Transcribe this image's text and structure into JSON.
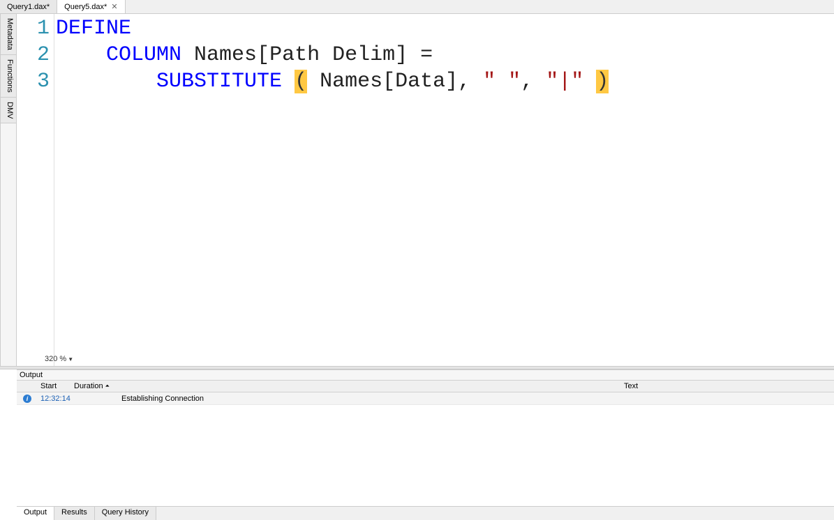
{
  "tabs": [
    {
      "label": "Query1.dax*"
    },
    {
      "label": "Query5.dax*"
    }
  ],
  "side_tabs": {
    "metadata": "Metadata",
    "functions": "Functions",
    "dmv": "DMV"
  },
  "editor": {
    "lines": [
      "1",
      "2",
      "3"
    ],
    "code": {
      "l1_define": "DEFINE",
      "l2_indent": "    ",
      "l2_column": "COLUMN",
      "l2_rest": " Names[Path Delim] =",
      "l3_indent": "        ",
      "l3_fn": "SUBSTITUTE",
      "l3_sp1": " ",
      "l3_open": "(",
      "l3_arg": " Names[Data]",
      "l3_comma1": ",",
      "l3_sp2": " ",
      "l3_str1": "\" \"",
      "l3_comma2": ",",
      "l3_sp3": " ",
      "l3_str2": "\"|\"",
      "l3_sp4": " ",
      "l3_close": ")"
    },
    "zoom": "320 %"
  },
  "output": {
    "title": "Output",
    "columns": {
      "start": "Start",
      "duration": "Duration",
      "text": "Text"
    },
    "rows": [
      {
        "start": "12:32:14",
        "duration": "",
        "text": "Establishing Connection"
      }
    ]
  },
  "bottom_tabs": {
    "output": "Output",
    "results": "Results",
    "history": "Query History"
  }
}
